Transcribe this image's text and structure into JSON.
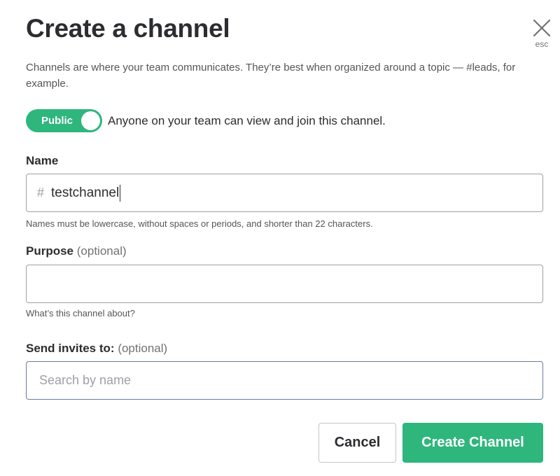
{
  "dialog": {
    "title": "Create a channel",
    "close_hint": "esc",
    "description": "Channels are where your team communicates. They’re best when organized around a topic — #leads, for example."
  },
  "visibility": {
    "toggle_label": "Public",
    "toggle_state": "on",
    "toggle_description": "Anyone on your team can view and join this channel."
  },
  "name_field": {
    "label": "Name",
    "prefix": "#",
    "value": "testchannel",
    "hint": "Names must be lowercase, without spaces or periods, and shorter than 22 characters."
  },
  "purpose_field": {
    "label": "Purpose",
    "optional_text": "(optional)",
    "value": "",
    "hint": "What’s this channel about?"
  },
  "invites_field": {
    "label": "Send invites to:",
    "optional_text": "(optional)",
    "placeholder": "Search by name"
  },
  "actions": {
    "cancel_label": "Cancel",
    "create_label": "Create Channel"
  },
  "colors": {
    "accent_green": "#2eb67d",
    "text_primary": "#2c2d30",
    "text_secondary": "#555459"
  },
  "icons": {
    "close": "close-icon"
  }
}
